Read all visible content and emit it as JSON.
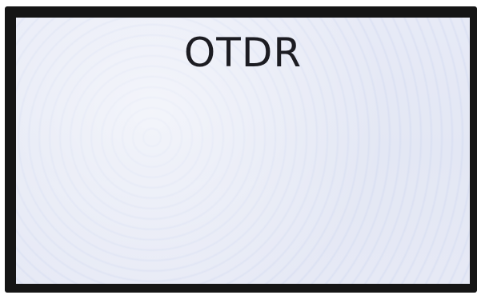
{
  "screen": {
    "title": "OTDR"
  },
  "colors": {
    "bezel": "#151515",
    "screen_background": "#e6e9f5",
    "title_text": "#1c1c22"
  }
}
